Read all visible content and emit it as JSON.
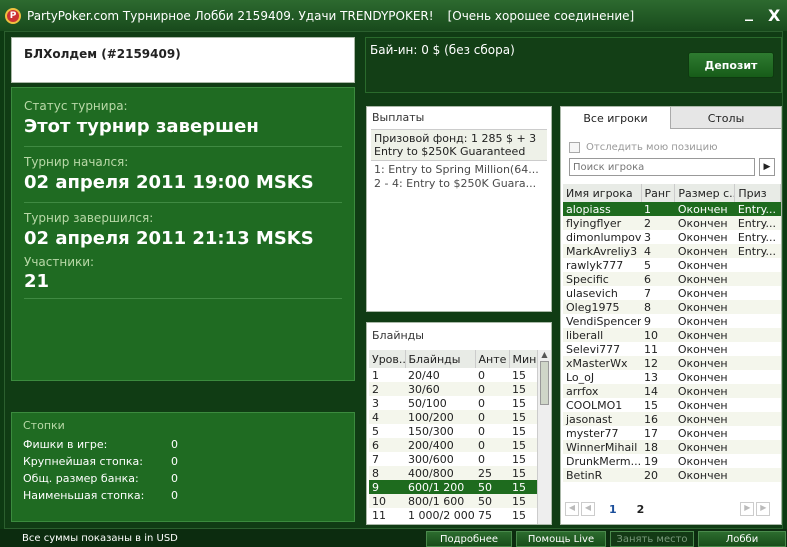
{
  "window": {
    "title": "PartyPoker.com Турнирное Лобби 2159409. Удачи TRENDYPOKER!",
    "connection": "[Очень хорошее соединение]",
    "minimize": "_",
    "close": "X"
  },
  "tournament": {
    "name": "БЛХолдем (#2159409)",
    "status_label": "Статус турнира:",
    "status_value": "Этот турнир завершен",
    "started_label": "Турнир начался:",
    "started_value": "02 апреля 2011  19:00 MSKS",
    "ended_label": "Турнир завершился:",
    "ended_value": "02 апреля 2011  21:13 MSKS",
    "players_label": "Участники:",
    "players_value": "21"
  },
  "buyin": {
    "text": "Бай-ин: 0 $ (без сбора)",
    "deposit_button": "Депозит"
  },
  "stacks": {
    "title": "Стопки",
    "rows": [
      {
        "label": "Фишки в игре:",
        "value": "0"
      },
      {
        "label": "Крупнейшая стопка:",
        "value": "0"
      },
      {
        "label": "Общ. размер банка:",
        "value": "0"
      },
      {
        "label": "Наименьшая стопка:",
        "value": "0"
      }
    ]
  },
  "payouts": {
    "title": "Выплаты",
    "prize_pool": "Призовой фонд: 1 285 $ + 3 Entry to $250K Guaranteed",
    "items": [
      "1: Entry to Spring Million(64...",
      "2 - 4: Entry to $250K Guara..."
    ]
  },
  "blinds": {
    "title": "Блайнды",
    "columns": [
      "Уров...",
      "Блайнды",
      "Анте",
      "Мин"
    ],
    "rows": [
      [
        "1",
        "20/40",
        "0",
        "15"
      ],
      [
        "2",
        "30/60",
        "0",
        "15"
      ],
      [
        "3",
        "50/100",
        "0",
        "15"
      ],
      [
        "4",
        "100/200",
        "0",
        "15"
      ],
      [
        "5",
        "150/300",
        "0",
        "15"
      ],
      [
        "6",
        "200/400",
        "0",
        "15"
      ],
      [
        "7",
        "300/600",
        "0",
        "15"
      ],
      [
        "8",
        "400/800",
        "25",
        "15"
      ],
      [
        "9",
        "600/1 200",
        "50",
        "15"
      ],
      [
        "10",
        "800/1 600",
        "50",
        "15"
      ],
      [
        "11",
        "1 000/2 000",
        "75",
        "15"
      ]
    ],
    "selected_index": 8
  },
  "players": {
    "tabs": [
      "Все игроки",
      "Столы"
    ],
    "track_label": "Отследить мою позицию",
    "search_placeholder": "Поиск игрока",
    "columns": [
      "Имя игрока",
      "Ранг",
      "Размер с...",
      "Приз"
    ],
    "rows": [
      [
        "alopiass",
        "1",
        "Окончен",
        "Entry..."
      ],
      [
        "flyingflyer",
        "2",
        "Окончен",
        "Entry..."
      ],
      [
        "dimonlumpov",
        "3",
        "Окончен",
        "Entry..."
      ],
      [
        "MarkAvreliy3",
        "4",
        "Окончен",
        "Entry..."
      ],
      [
        "rawlyk777",
        "5",
        "Окончен",
        ""
      ],
      [
        "Specific",
        "6",
        "Окончен",
        ""
      ],
      [
        "ulasevich",
        "7",
        "Окончен",
        ""
      ],
      [
        "Oleg1975",
        "8",
        "Окончен",
        ""
      ],
      [
        "VendiSpencer",
        "9",
        "Окончен",
        ""
      ],
      [
        "liberall",
        "10",
        "Окончен",
        ""
      ],
      [
        "Selevi777",
        "11",
        "Окончен",
        ""
      ],
      [
        "xMasterWx",
        "12",
        "Окончен",
        ""
      ],
      [
        "Lo_oJ",
        "13",
        "Окончен",
        ""
      ],
      [
        "arrfox",
        "14",
        "Окончен",
        ""
      ],
      [
        "COOLMO1",
        "15",
        "Окончен",
        ""
      ],
      [
        "jasonast",
        "16",
        "Окончен",
        ""
      ],
      [
        "myster77",
        "17",
        "Окончен",
        ""
      ],
      [
        "WinnerMihail",
        "18",
        "Окончен",
        ""
      ],
      [
        "DrunkMerm...",
        "19",
        "Окончен",
        ""
      ],
      [
        "BetinR",
        "20",
        "Окончен",
        ""
      ]
    ],
    "selected_index": 0,
    "pages": [
      "1",
      "2"
    ]
  },
  "footer": {
    "note": "Все суммы показаны в in USD",
    "more": "Подробнее",
    "help": "Помощь Live",
    "take_seat": "Занять место",
    "lobby": "Лобби"
  }
}
